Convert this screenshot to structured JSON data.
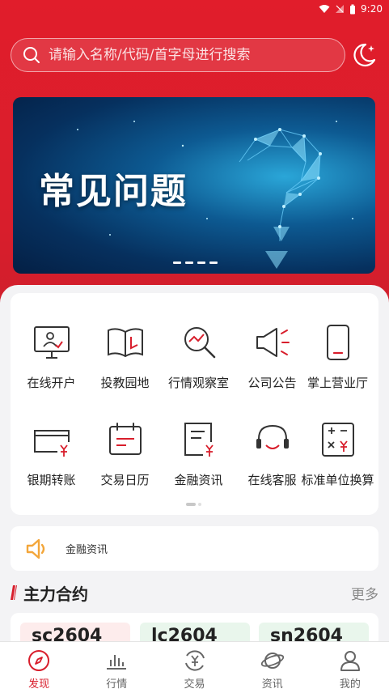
{
  "status_bar": {
    "time": "9:20"
  },
  "search": {
    "placeholder": "请输入名称/代码/首字母进行搜索",
    "value": ""
  },
  "banner": {
    "title": "常见问题",
    "page_count": 4,
    "current_page": 1
  },
  "grid": {
    "items": [
      {
        "label": "在线开户",
        "icon": "monitor-person-icon"
      },
      {
        "label": "投教园地",
        "icon": "open-book-icon"
      },
      {
        "label": "行情观察室",
        "icon": "magnifier-chart-icon"
      },
      {
        "label": "公司公告",
        "icon": "megaphone-icon"
      },
      {
        "label": "掌上营业厅",
        "icon": "phone-icon"
      },
      {
        "label": "银期转账",
        "icon": "card-yuan-icon"
      },
      {
        "label": "交易日历",
        "icon": "calendar-icon"
      },
      {
        "label": "金融资讯",
        "icon": "document-yuan-icon"
      },
      {
        "label": "在线客服",
        "icon": "headset-icon"
      },
      {
        "label": "标准单位换算",
        "icon": "calculator-icon"
      }
    ]
  },
  "news": {
    "label": "金融资讯"
  },
  "section": {
    "title": "主力合约",
    "more": "更多"
  },
  "contracts": [
    {
      "name": "sc2604",
      "bg": "#fdecec"
    },
    {
      "name": "lc2604",
      "bg": "#e9f6ec"
    },
    {
      "name": "sn2604",
      "bg": "#e9f6ec"
    }
  ],
  "colors": {
    "brand": "#d81e2c",
    "accent_icon": "#f3a63a"
  },
  "tabs": [
    {
      "label": "发现",
      "icon": "compass-icon",
      "active": true
    },
    {
      "label": "行情",
      "icon": "bar-chart-icon",
      "active": false
    },
    {
      "label": "交易",
      "icon": "yuan-cycle-icon",
      "active": false
    },
    {
      "label": "资讯",
      "icon": "planet-icon",
      "active": false
    },
    {
      "label": "我的",
      "icon": "user-icon",
      "active": false
    }
  ]
}
